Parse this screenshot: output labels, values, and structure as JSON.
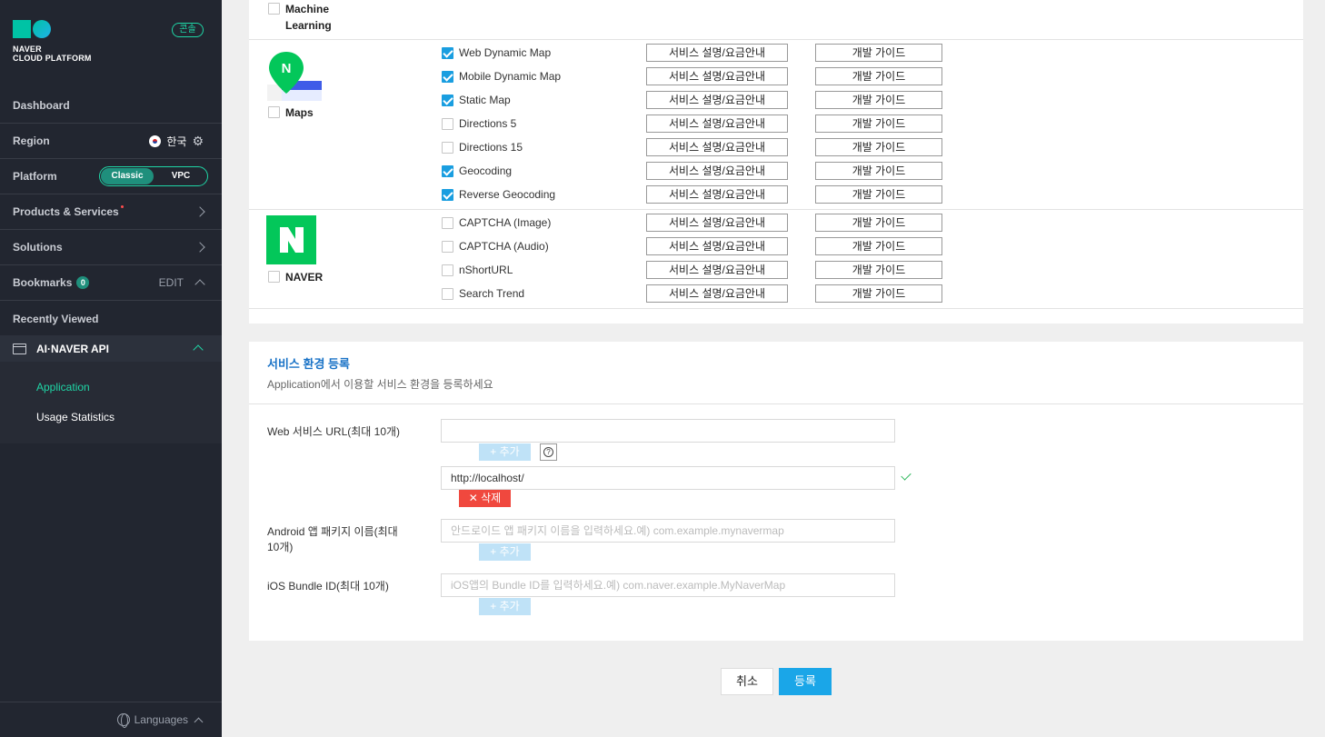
{
  "sidebar": {
    "logo_line1": "NAVER",
    "logo_line2": "CLOUD PLATFORM",
    "console_badge": "콘솔",
    "dashboard": "Dashboard",
    "region_label": "Region",
    "region_value": "한국",
    "platform_label": "Platform",
    "platform_options": [
      "Classic",
      "VPC"
    ],
    "platform_selected": "Classic",
    "products": "Products & Services",
    "solutions": "Solutions",
    "bookmarks": "Bookmarks",
    "bookmarks_count": "0",
    "bookmarks_edit": "EDIT",
    "recently_viewed": "Recently Viewed",
    "api_section": "AI·NAVER API",
    "sub_items": [
      "Application",
      "Usage Statistics"
    ],
    "languages": "Languages",
    "accent_color": "#1fd6a6"
  },
  "api_list": {
    "desc_button": "서비스 설명/요금안내",
    "guide_button": "개발 가이드",
    "machine_learning_label": "Machine Learning",
    "maps": {
      "label": "Maps",
      "items": [
        {
          "name": "Web Dynamic Map",
          "checked": true
        },
        {
          "name": "Mobile Dynamic Map",
          "checked": true
        },
        {
          "name": "Static Map",
          "checked": true
        },
        {
          "name": "Directions 5",
          "checked": false
        },
        {
          "name": "Directions 15",
          "checked": false
        },
        {
          "name": "Geocoding",
          "checked": true
        },
        {
          "name": "Reverse Geocoding",
          "checked": true
        }
      ]
    },
    "naver": {
      "label": "NAVER",
      "items": [
        {
          "name": "CAPTCHA (Image)",
          "checked": false
        },
        {
          "name": "CAPTCHA (Audio)",
          "checked": false
        },
        {
          "name": "nShortURL",
          "checked": false
        },
        {
          "name": "Search Trend",
          "checked": false
        }
      ]
    }
  },
  "env": {
    "title": "서비스 환경 등록",
    "desc": "Application에서 이용할 서비스 환경을 등록하세요",
    "web_label": "Web 서비스 URL(최대 10개)",
    "web_url_value": "http://localhost/",
    "add_label": "추가",
    "help_label": "?",
    "delete_label": "삭제",
    "android_label": "Android 앱 패키지 이름(최대 10개)",
    "android_placeholder": "안드로이드 앱 패키지 이름을 입력하세요.예) com.example.mynavermap",
    "ios_label": "iOS Bundle ID(최대 10개)",
    "ios_placeholder": "iOS앱의 Bundle ID를 입력하세요.예) com.naver.example.MyNaverMap"
  },
  "actions": {
    "cancel": "취소",
    "submit": "등록"
  }
}
